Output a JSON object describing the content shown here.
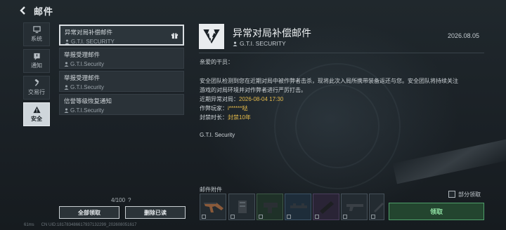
{
  "header": {
    "title": "邮件"
  },
  "nav": {
    "items": [
      {
        "label": "系统",
        "icon": "monitor-icon"
      },
      {
        "label": "通知",
        "icon": "notice-icon"
      },
      {
        "label": "交易行",
        "icon": "gavel-icon"
      },
      {
        "label": "安全",
        "icon": "warning-icon",
        "active": true
      }
    ]
  },
  "mail_list": {
    "items": [
      {
        "title": "异常对局补偿邮件",
        "sender": "G.T.I. SECURITY",
        "has_gift": true,
        "active": true
      },
      {
        "title": "举报受理邮件",
        "sender": "G.T.I.Security"
      },
      {
        "title": "举报受理邮件",
        "sender": "G.T.I.Security"
      },
      {
        "title": "信誉等级恢复通知",
        "sender": "G.T.I.Security"
      }
    ],
    "count": "4/100",
    "count_help": "?",
    "claim_all_label": "全部领取",
    "delete_read_label": "删除已读"
  },
  "detail": {
    "title": "异常对局补偿邮件",
    "sender": "G.T.I. SECURITY",
    "date": "2026.08.05",
    "greeting": "亲爱的干员：",
    "body_line1": "安全团队检测到您在近期对局中被作弊者击杀，现将此次入局所携带装备返还与您。安全团队将持续关注",
    "body_line2": "游戏的对局环境并对作弊者进行严厉打击。",
    "match_label": "近期异常对局：",
    "match_value": "2026-08-04 17:30",
    "cheater_label": "作弊玩家：",
    "cheater_value": "i******哒",
    "ban_label": "封禁时长：",
    "ban_value": "封禁10年",
    "signature": "G.T.I. Security"
  },
  "attachments": {
    "label": "邮件附件",
    "partial_label": "部分领取",
    "claim_label": "领取",
    "items": [
      {
        "icon": "rifle-icon"
      },
      {
        "icon": "magazine-icon"
      },
      {
        "icon": "grip-icon"
      },
      {
        "icon": "scope-mount-icon"
      },
      {
        "icon": "rail-icon"
      },
      {
        "icon": "stock-icon"
      },
      {
        "icon": "barrel-icon"
      }
    ]
  },
  "status_bar": {
    "ping": "61ms",
    "uid": "CN UID:1817834866179371322​99_202608051617"
  },
  "colors": {
    "accent_green": "#4fa06a",
    "highlight": "#e3b94a",
    "background": "#1b2227"
  }
}
